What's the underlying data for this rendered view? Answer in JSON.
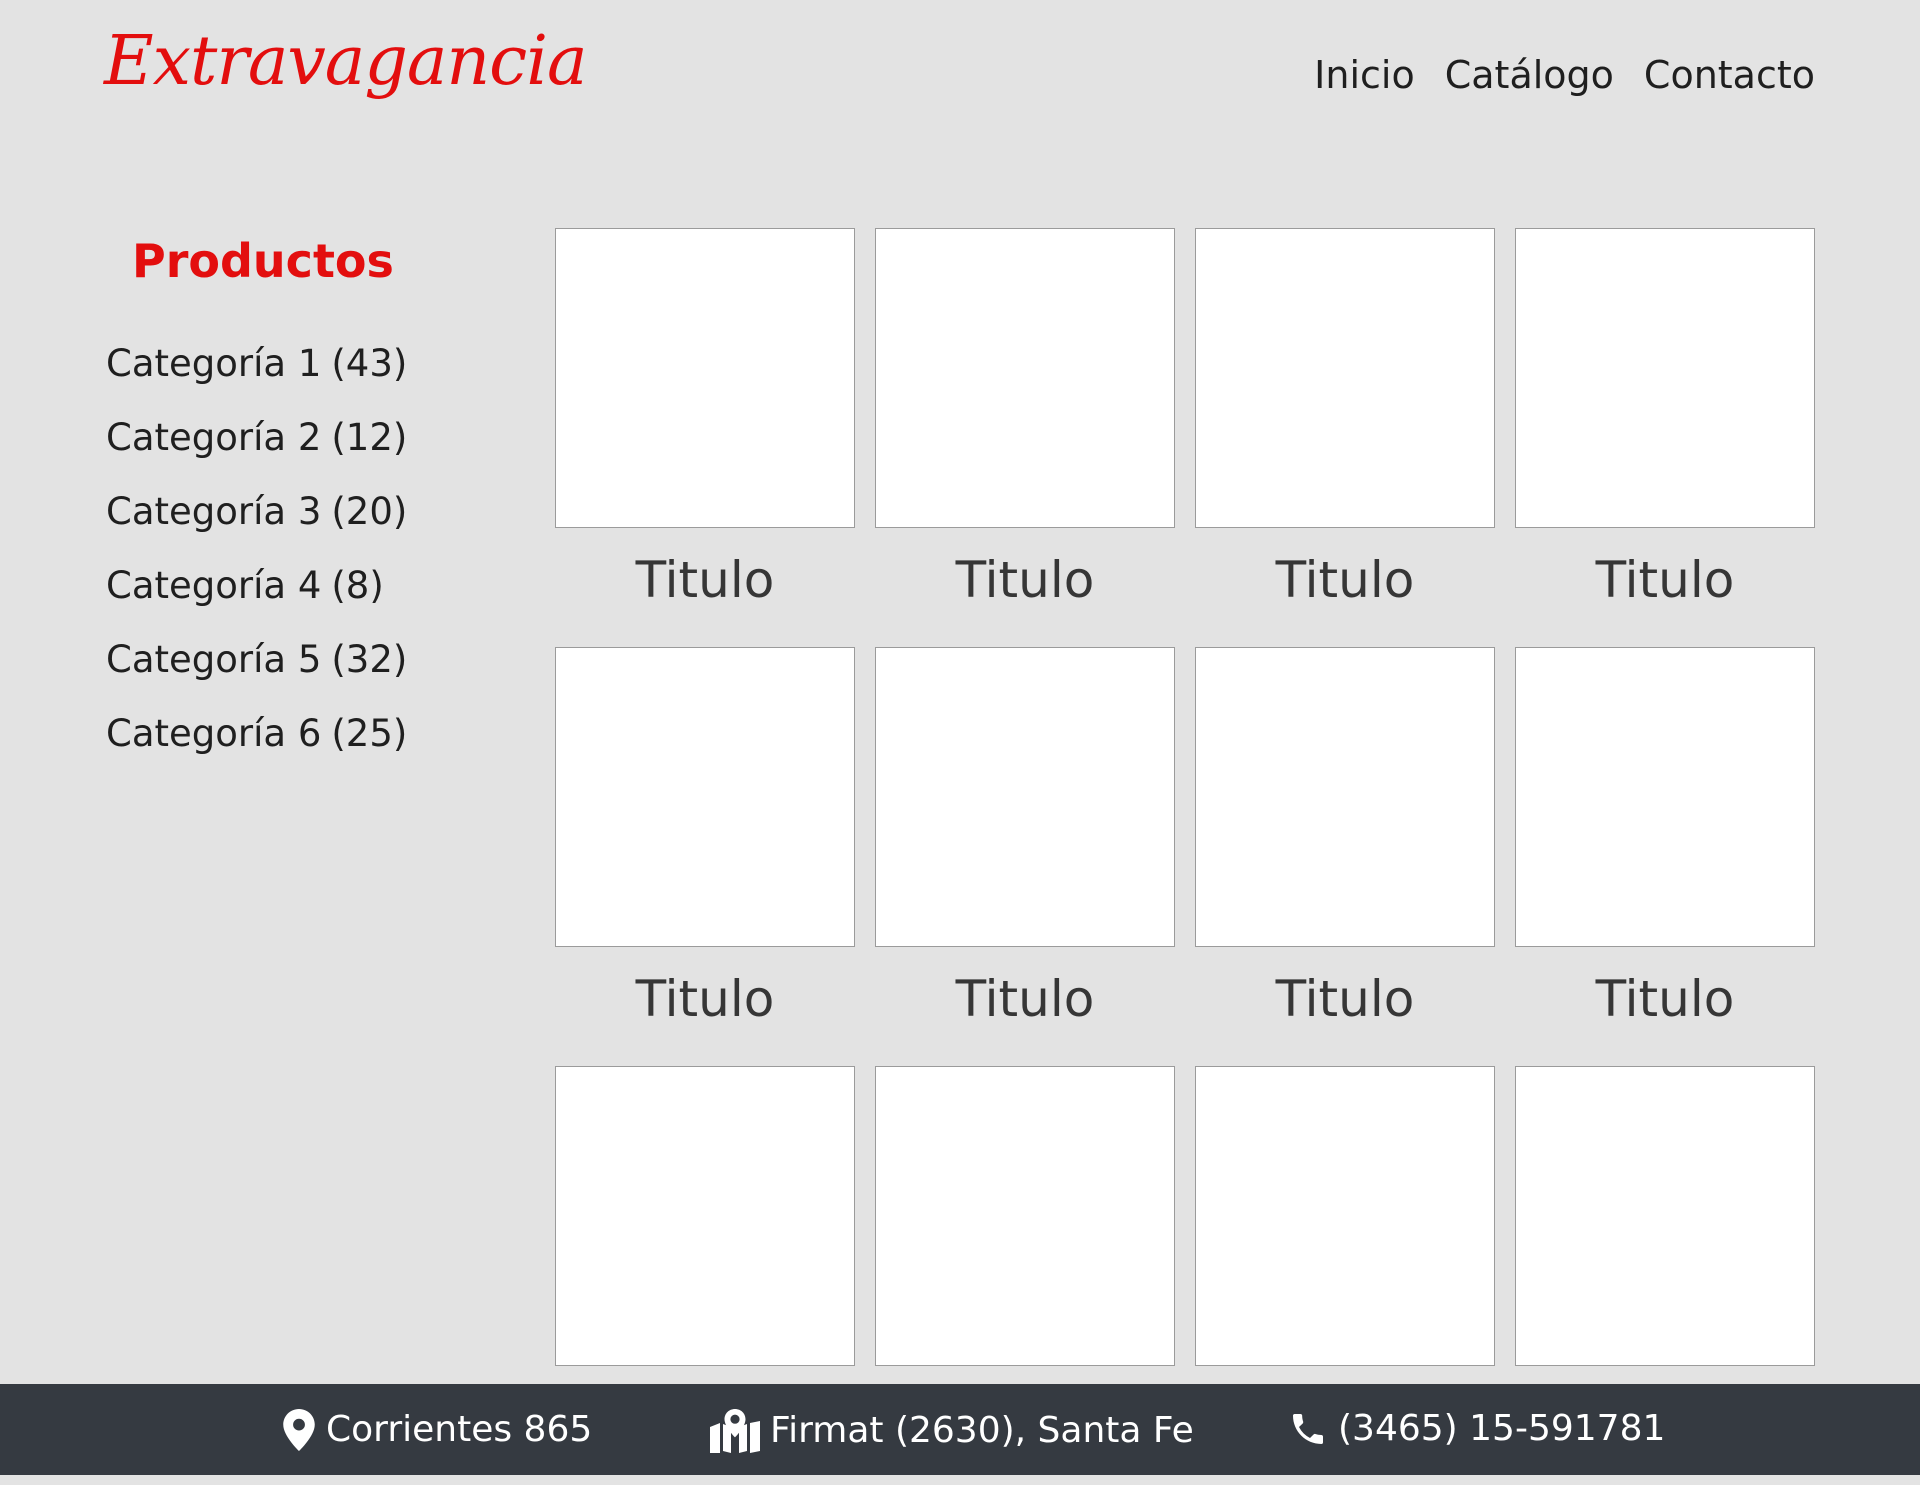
{
  "header": {
    "logo": "Extravagancia",
    "nav": [
      "Inicio",
      "Catálogo",
      "Contacto"
    ]
  },
  "sidebar": {
    "title": "Productos",
    "categories": [
      {
        "label": "Categoría 1",
        "count": "(43)"
      },
      {
        "label": "Categoría 2",
        "count": "(12)"
      },
      {
        "label": "Categoría 3",
        "count": "(20)"
      },
      {
        "label": "Categoría 4",
        "count": "(8)"
      },
      {
        "label": "Categoría 5",
        "count": "(32)"
      },
      {
        "label": "Categoría 6",
        "count": "(25)"
      }
    ]
  },
  "products": [
    {
      "title": "Titulo"
    },
    {
      "title": "Titulo"
    },
    {
      "title": "Titulo"
    },
    {
      "title": "Titulo"
    },
    {
      "title": "Titulo"
    },
    {
      "title": "Titulo"
    },
    {
      "title": "Titulo"
    },
    {
      "title": "Titulo"
    },
    {
      "title": ""
    },
    {
      "title": ""
    },
    {
      "title": ""
    },
    {
      "title": ""
    }
  ],
  "footer": {
    "address": "Corrientes 865",
    "city": "Firmat (2630), Santa Fe",
    "phone": "(3465) 15-591781",
    "icons": [
      "map-marker-icon",
      "map-icon",
      "phone-icon"
    ]
  },
  "colors": {
    "brand": "#e30e0e",
    "background": "#e3e3e3",
    "footer": "#353a41"
  }
}
